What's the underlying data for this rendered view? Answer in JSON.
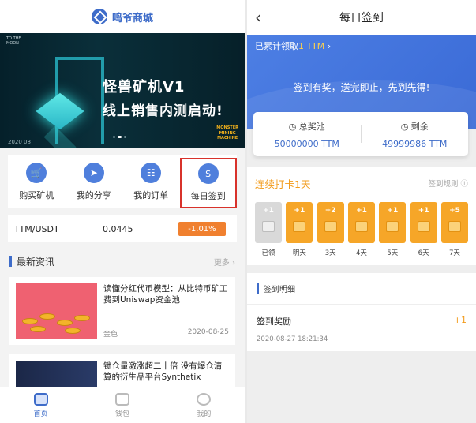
{
  "left": {
    "brand": "鸣爷商城",
    "banner": {
      "corner_text": "TO THE MOON",
      "title_line1": "怪兽矿机V1",
      "title_line2": "线上销售内测启动!",
      "year": "2020 08",
      "brand_lines": [
        "MONSTER",
        "MINING",
        "MACHINE"
      ]
    },
    "quick_actions": [
      {
        "label": "购买矿机",
        "icon": "cart-icon"
      },
      {
        "label": "我的分享",
        "icon": "share-icon"
      },
      {
        "label": "我的订单",
        "icon": "order-icon"
      },
      {
        "label": "每日签到",
        "icon": "checkin-icon"
      }
    ],
    "ticker": {
      "pair": "TTM/USDT",
      "price": "0.0445",
      "change": "-1.01%"
    },
    "news": {
      "title": "最新资讯",
      "more": "更多",
      "items": [
        {
          "headline": "读懂分红代币模型：从比特币矿工费到Uniswap资金池",
          "source": "金色",
          "date": "2020-08-25"
        },
        {
          "headline": "锁仓量激涨超二十倍 没有爆仓清算的衍生品平台Synthetix"
        }
      ]
    },
    "tabs": [
      {
        "label": "首页",
        "active": true
      },
      {
        "label": "钱包",
        "active": false
      },
      {
        "label": "我的",
        "active": false
      }
    ]
  },
  "right": {
    "title": "每日签到",
    "cumulative_prefix": "已累计领取",
    "cumulative_value": "1 TTM",
    "slogan": "签到有奖，送完即止，先到先得!",
    "pool": {
      "total_label": "总奖池",
      "total_value": "50000000 TTM",
      "remain_label": "剩余",
      "remain_value": "49999986 TTM"
    },
    "streak": {
      "label": "连续打卡1天",
      "rules": "签到规则",
      "days": [
        {
          "points": "+1",
          "label": "已领",
          "done": true
        },
        {
          "points": "+1",
          "label": "明天",
          "done": false
        },
        {
          "points": "+2",
          "label": "3天",
          "done": false
        },
        {
          "points": "+1",
          "label": "4天",
          "done": false
        },
        {
          "points": "+1",
          "label": "5天",
          "done": false
        },
        {
          "points": "+1",
          "label": "6天",
          "done": false
        },
        {
          "points": "+5",
          "label": "7天",
          "done": false
        }
      ]
    },
    "detail": {
      "title": "签到明细",
      "record": {
        "name": "签到奖励",
        "amount": "+1",
        "time": "2020-08-27 18:21:34"
      }
    }
  },
  "colors": {
    "accent": "#3e6cc9",
    "orange": "#f6a628",
    "highlight_red": "#d8322b"
  }
}
